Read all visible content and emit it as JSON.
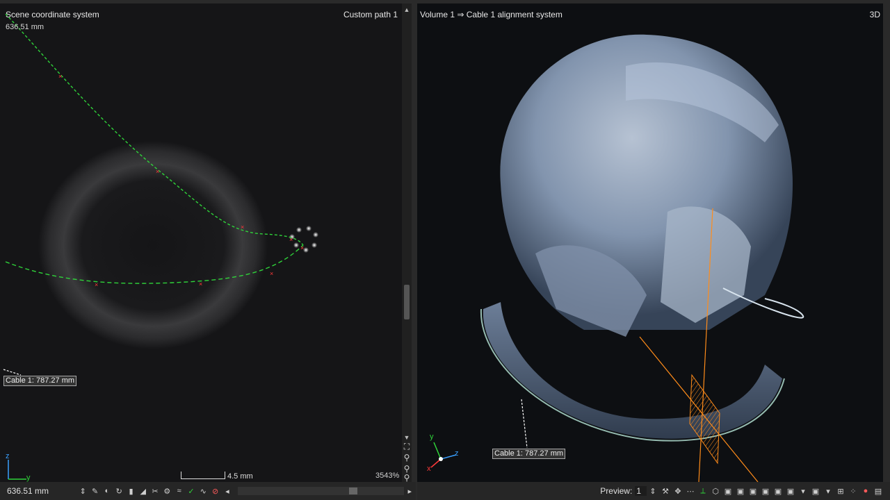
{
  "left_view": {
    "title": "Scene coordinate system",
    "path_label": "Custom path 1",
    "distance": "636.51 mm",
    "cable_tag": "Cable 1: 787.27 mm",
    "scale_label": "4.5 mm",
    "zoom_level": "3543%",
    "axis_z": "z",
    "axis_y": "y"
  },
  "right_view": {
    "title": "Volume 1 ⇒ Cable 1 alignment system",
    "mode_label": "3D",
    "cable_tag": "Cable 1: 787.27 mm",
    "axis_y": "y",
    "axis_z": "z",
    "axis_x": "x"
  },
  "bottom_toolbar": {
    "distance_field": "636.51 mm",
    "preview_label": "Preview:",
    "preview_value": "1"
  },
  "colors": {
    "path_green": "#2fd43a",
    "marker_red": "#ff3a3a",
    "cable_orange": "#ff8c1a",
    "helmet_blue": "#9fb3cf"
  },
  "icons": [
    "up-arrow-icon",
    "down-arrow-icon",
    "fit-view-icon",
    "zoom-out-icon",
    "zoom-in-icon",
    "search-icon",
    "settings-icon",
    "move-icon",
    "rotate-icon",
    "cube-icon",
    "camera-icon",
    "light-icon"
  ]
}
